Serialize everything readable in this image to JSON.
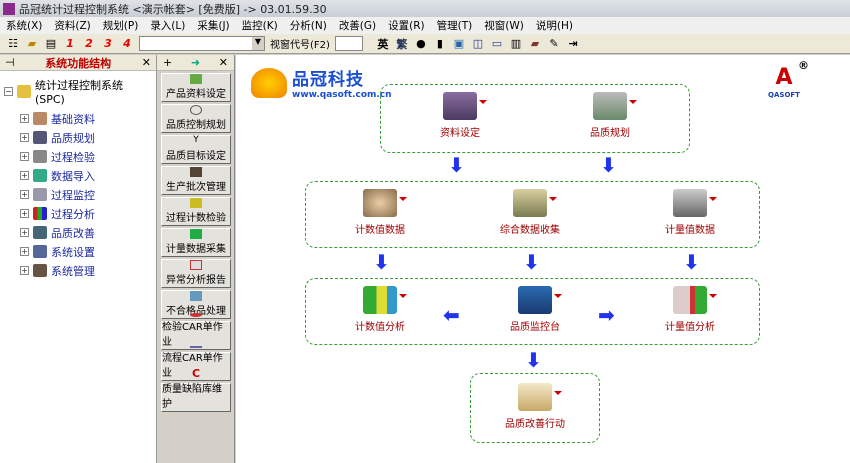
{
  "title": "品冠统计过程控制系统 <演示帐套> [免费版] -> 03.01.59.30",
  "menu": [
    "系统(X)",
    "资料(Z)",
    "规划(P)",
    "录入(L)",
    "采集(J)",
    "监控(K)",
    "分析(N)",
    "改善(G)",
    "设置(R)",
    "管理(T)",
    "视窗(W)",
    "说明(H)"
  ],
  "toolbar": {
    "nums": [
      "1",
      "2",
      "3",
      "4"
    ],
    "window_code_label": "视窗代号(F2)",
    "lang_en": "英",
    "lang_trad": "繁"
  },
  "tree": {
    "title": "系统功能结构",
    "root": "统计过程控制系统 (SPC)",
    "items": [
      "基础资料",
      "品质规划",
      "过程检验",
      "数据导入",
      "过程监控",
      "过程分析",
      "品质改善",
      "系统设置",
      "系统管理"
    ]
  },
  "quick": {
    "buttons": [
      "产品资料设定",
      "品质控制规划",
      "品质目标设定",
      "生产批次管理",
      "过程计数检验",
      "计量数据采集",
      "异常分析报告",
      "不合格品处理",
      "检验CAR单作业",
      "流程CAR单作业",
      "质量缺陷库维护"
    ]
  },
  "logo": {
    "name": "品冠科技",
    "url": "www.qasoft.com.cn",
    "brand": "QASOFT",
    "reg": "®"
  },
  "flow": {
    "n1": "资料设定",
    "n2": "品质规划",
    "n3": "计数值数据",
    "n4": "综合数据收集",
    "n5": "计量值数据",
    "n6": "计数值分析",
    "n7": "品质监控台",
    "n8": "计量值分析",
    "n9": "品质改善行动"
  }
}
